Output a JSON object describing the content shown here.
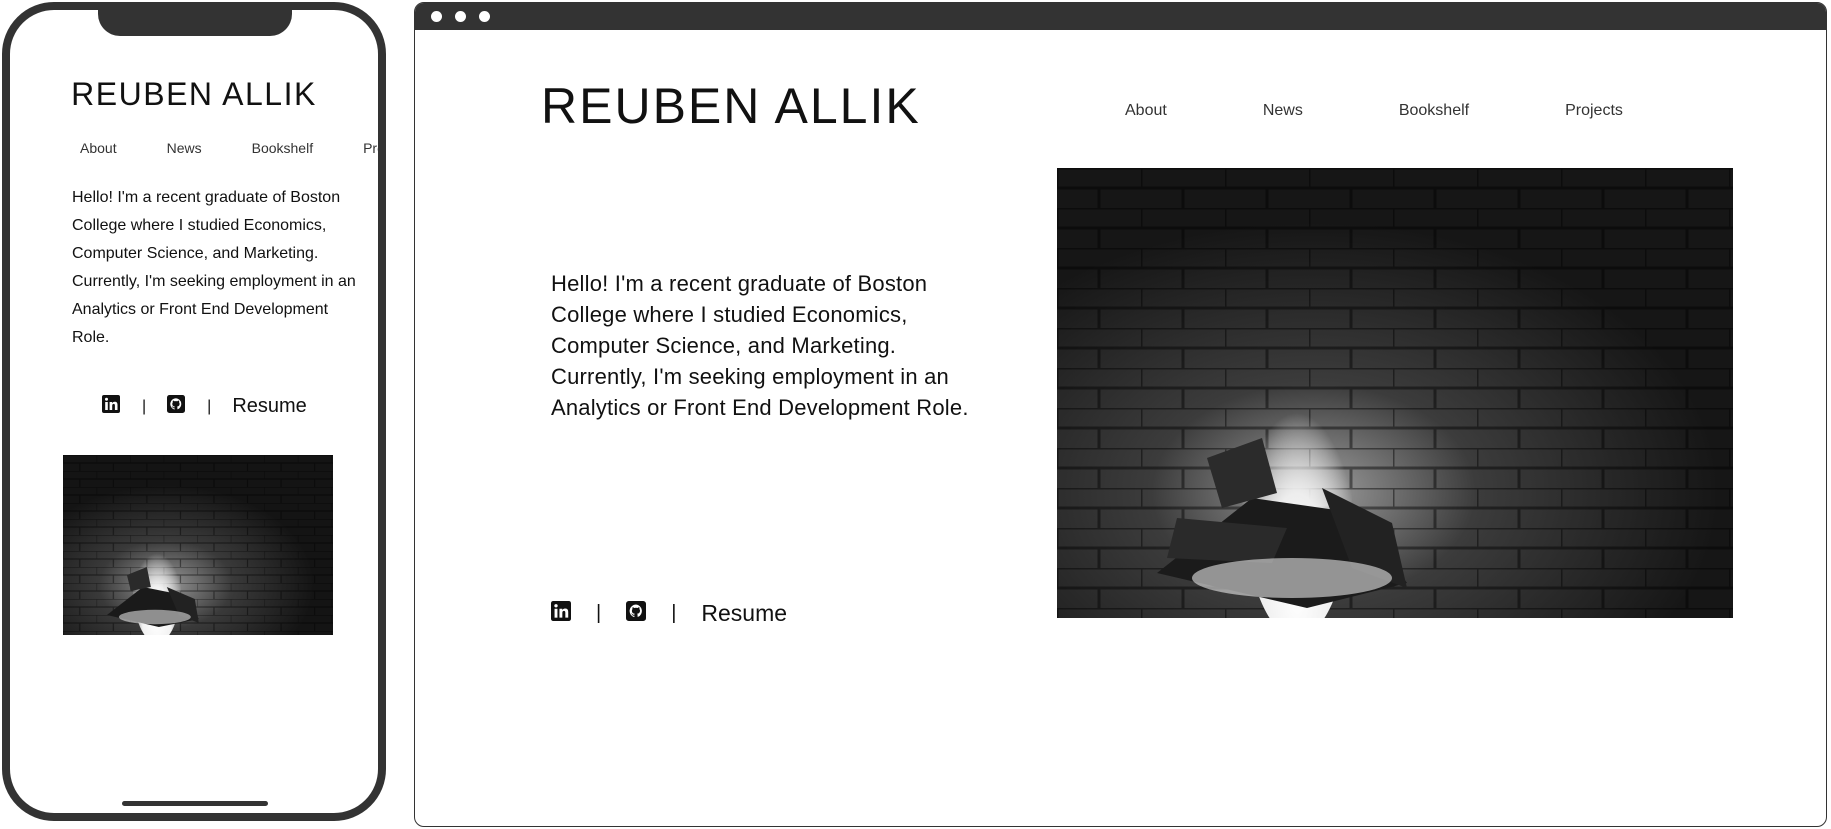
{
  "site": {
    "name": "REUBEN ALLIK",
    "nav": [
      "About",
      "News",
      "Bookshelf",
      "Projects"
    ],
    "bio": "Hello! I'm a recent graduate of Boston College where I studied Economics, Computer Science, and Marketing. Currently, I'm seeking employment in an Analytics or Front End Development Role.",
    "social": {
      "linkedin_icon": "linkedin-icon",
      "github_icon": "github-icon",
      "separator": "|",
      "resume_label": "Resume"
    },
    "hero_image": "fireplace-photo",
    "colors": {
      "frame": "#333333",
      "text": "#111111",
      "background": "#ffffff"
    }
  }
}
